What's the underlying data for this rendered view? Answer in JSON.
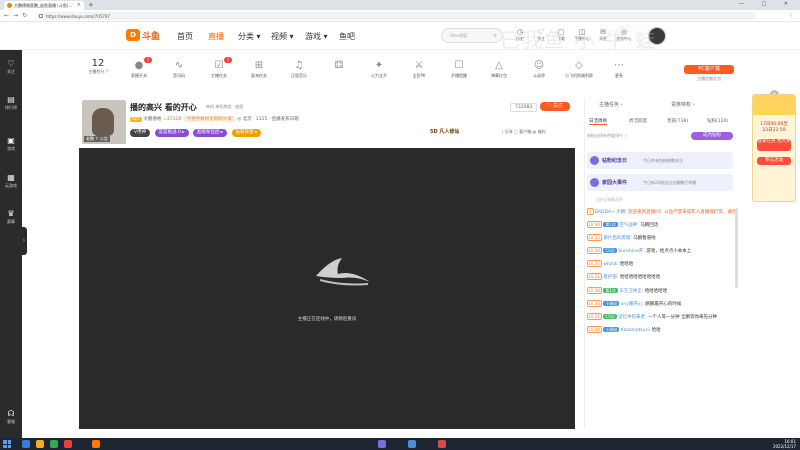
{
  "browser": {
    "tab_title": "大鹏德格医鹏_鲨鱼直播 (斗鱼)...",
    "url": "https://www.douyu.com/705797",
    "controls": [
      "—",
      "□",
      "✕"
    ]
  },
  "header": {
    "logo": "斗鱼",
    "nav": [
      {
        "label": "首页",
        "active": false
      },
      {
        "label": "直播",
        "active": true
      },
      {
        "label": "分类 ▾",
        "active": false
      },
      {
        "label": "视频 ▾",
        "active": false
      },
      {
        "label": "游戏 ▾",
        "active": false
      },
      {
        "label": "鱼吧",
        "active": false
      }
    ],
    "search_placeholder": "dleai搜索",
    "icons": [
      {
        "glyph": "◷",
        "label": "历史"
      },
      {
        "glyph": "♡",
        "label": "关注"
      },
      {
        "glyph": "▢",
        "label": "下载"
      },
      {
        "glyph": "◫",
        "label": "手播中心"
      },
      {
        "glyph": "✉",
        "label": "消息"
      },
      {
        "glyph": "◎",
        "label": "创作中心"
      }
    ],
    "watermark": "已我鱼 小 牛 蛙"
  },
  "sidebar": {
    "items": [
      {
        "icon": "♡",
        "label": "关注"
      },
      {
        "icon": "▤",
        "label": "排行榜"
      },
      {
        "icon": "▣",
        "label": "游戏"
      },
      {
        "icon": "▦",
        "label": "云游戏"
      },
      {
        "icon": "♛",
        "label": "赛事"
      },
      {
        "icon": "☊",
        "label": "客服"
      }
    ],
    "toggle": "›"
  },
  "featbar": {
    "level_number": "12",
    "level_label": "主播积分 ?",
    "items": [
      {
        "icon": "●",
        "label": "直播开关",
        "badge": "1"
      },
      {
        "icon": "∿",
        "label": "音讯码",
        "badge": ""
      },
      {
        "icon": "☑",
        "label": "主播任务",
        "badge": "1"
      },
      {
        "icon": "⊞",
        "label": "星海任务",
        "badge": ""
      },
      {
        "icon": "♫",
        "label": "正版音乐",
        "badge": ""
      },
      {
        "icon": "⚃",
        "label": "",
        "badge": ""
      },
      {
        "icon": "✦",
        "label": "火力全开",
        "badge": ""
      },
      {
        "icon": "⚔",
        "label": "全民PK",
        "badge": ""
      },
      {
        "icon": "☐",
        "label": "开播提醒",
        "badge": ""
      },
      {
        "icon": "△",
        "label": "弹幕红包",
        "badge": ""
      },
      {
        "icon": "☺",
        "label": "斗幼停",
        "badge": ""
      },
      {
        "icon": "◇",
        "label": "小飞机到福利群",
        "badge": ""
      },
      {
        "icon": "⋯",
        "label": "更多",
        "badge": ""
      }
    ],
    "pc_client": "PC客户端",
    "pc_client_sub": "主播定制礼包"
  },
  "room": {
    "title": "播的高兴 看的开心",
    "category": "单机  单机热游 · 旅游",
    "level": "LV1",
    "anchor_name": "大鹏德格",
    "hot_count": "37118",
    "tag": "\"手把手教你无限制大冒\"",
    "location": "◎ 北京 · 1315  · 直播发布日期",
    "avatar_caption": "老鹏 ↑ 公告",
    "badges": [
      "V用神",
      "篮篮挑战 0 ▸",
      "超级粉丝团 ▸",
      "钻粉获客 ▸"
    ],
    "sponsor": "5D 凡人修仙",
    "actions": "⟨ 分享   ▢ 客户端   ▤ 福利",
    "follow_count": "732083",
    "follow_label": "♡ 关注"
  },
  "player": {
    "message": "主播正在连线中，请稍后重试"
  },
  "right_panel": {
    "tabs": [
      "主播任务 ›",
      "贵族特权 ›"
    ],
    "sub_tabs": [
      "日活周榜",
      "周活跃度",
      "贵族(738)",
      "钻粉(120)"
    ],
    "desc": "按粉丝榜亲密度排行 ⓘ",
    "join_button": "成为钻粉",
    "events": [
      {
        "title": "钻粉纪念日",
        "desc": "今日共有钻粉被鹏关注"
      },
      {
        "title": "家园大事件",
        "desc": "今日有20粉丝出去踢鹏打鸡粮"
      }
    ],
    "notice": "当前无弹幕消息"
  },
  "chat": [
    {
      "level": "1",
      "fan": "",
      "user": "BADDA~ 大鹏:",
      "text": "欢迎来到直播间！斗鱼严禁未成年人直播或打赏，请勿相信任何刷卡、中奖等骗局。",
      "sys": true
    },
    {
      "level": "LV 36",
      "fan": "第1次",
      "user": "空气战神:",
      "text": "马鹏回话",
      "sys": false
    },
    {
      "level": "LV 33",
      "fan": "",
      "user": "斯片后的黑暗:",
      "text": "马鹏暂悬啦",
      "sys": false
    },
    {
      "level": "LV 26",
      "fan": "CS功",
      "user": "Sunshine开:",
      "text": "游戏，给点点小本本上",
      "sys": false
    },
    {
      "level": "LV 32",
      "fan": "",
      "user": "whzut:",
      "text": "哈哈哈",
      "sys": false
    },
    {
      "level": "LV 21",
      "fan": "",
      "user": "客护部:",
      "text": "哈哈哈哈哈哈哈哈哈",
      "sys": false
    },
    {
      "level": "LV 36",
      "fan": "第1次",
      "user": "东方卫休正:",
      "text": "哈哈哈哈哈",
      "sys": false
    },
    {
      "level": "LV 33",
      "fan": "小周娃",
      "user": "xny鹏开心:",
      "text": "鹏鹏最开心的时候",
      "sys": false
    },
    {
      "level": "LV 21",
      "fan": "CS功",
      "user": "记忆中的朱老:",
      "text": "一个人等一分钟 全鹏等你来先分钟",
      "sys": false
    },
    {
      "level": "LV 38",
      "fan": "小周娃",
      "user": "Kazamatsuri:",
      "text": "哈哈",
      "sys": false
    }
  ],
  "promo": {
    "line1": "17日00:00至",
    "line2": "23日23:59",
    "button1": "登录任务 抢大奖",
    "button2": "参与活动",
    "close": "×"
  },
  "taskbar": {
    "time": "16:01",
    "date": "2022/12/17"
  }
}
